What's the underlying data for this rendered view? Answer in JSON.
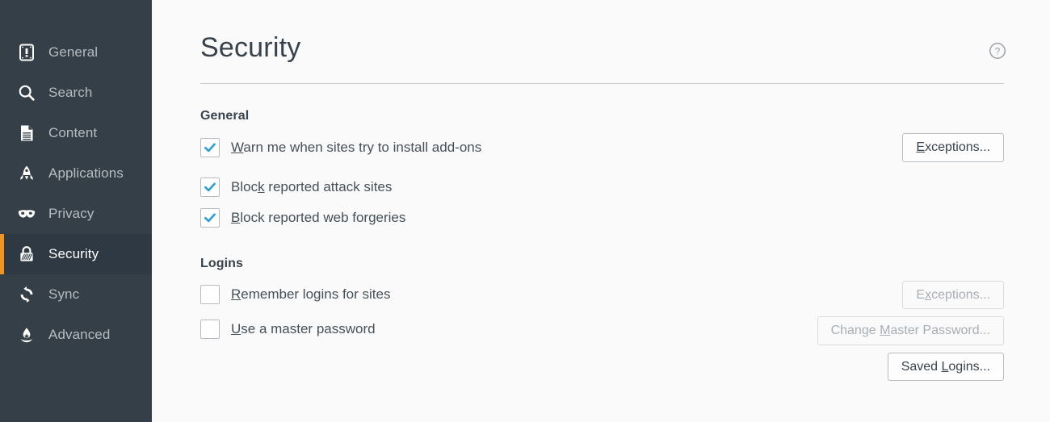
{
  "sidebar": {
    "items": [
      {
        "label": "General",
        "icon": "general-icon",
        "active": false
      },
      {
        "label": "Search",
        "icon": "search-icon",
        "active": false
      },
      {
        "label": "Content",
        "icon": "content-icon",
        "active": false
      },
      {
        "label": "Applications",
        "icon": "applications-icon",
        "active": false
      },
      {
        "label": "Privacy",
        "icon": "privacy-icon",
        "active": false
      },
      {
        "label": "Security",
        "icon": "security-icon",
        "active": true
      },
      {
        "label": "Sync",
        "icon": "sync-icon",
        "active": false
      },
      {
        "label": "Advanced",
        "icon": "advanced-icon",
        "active": false
      }
    ],
    "colors": {
      "background": "#343f48",
      "active_background": "#2e3943",
      "accent": "#f09422",
      "label": "#b5bcc2",
      "active_label": "#ffffff"
    }
  },
  "header": {
    "title": "Security",
    "help_icon": "help-circle-icon"
  },
  "general_section": {
    "title": "General",
    "items": [
      {
        "label_before": "",
        "accesskey": "W",
        "label_after": "arn me when sites try to install add-ons",
        "checked": true
      },
      {
        "label_before": "Bloc",
        "accesskey": "k",
        "label_after": " reported attack sites",
        "checked": true
      },
      {
        "label_before": "",
        "accesskey": "B",
        "label_after": "lock reported web forgeries",
        "checked": true
      }
    ],
    "exceptions_button": {
      "label_before": "",
      "accesskey": "E",
      "label_after": "xceptions...",
      "disabled": false
    }
  },
  "logins_section": {
    "title": "Logins",
    "items": [
      {
        "label_before": "",
        "accesskey": "R",
        "label_after": "emember logins for sites",
        "checked": false
      },
      {
        "label_before": "",
        "accesskey": "U",
        "label_after": "se a master password",
        "checked": false
      }
    ],
    "buttons": [
      {
        "label_before": "E",
        "accesskey": "x",
        "label_after": "ceptions...",
        "disabled": true
      },
      {
        "label_before": "Change ",
        "accesskey": "M",
        "label_after": "aster Password...",
        "disabled": true
      },
      {
        "label_before": "Saved ",
        "accesskey": "L",
        "label_after": "ogins...",
        "disabled": false
      }
    ]
  },
  "colors": {
    "main_background": "#fafafa",
    "title_text": "#38424d",
    "body_text": "#46505a",
    "checkmark": "#2b9ddb",
    "rule": "#c9cdd1"
  }
}
